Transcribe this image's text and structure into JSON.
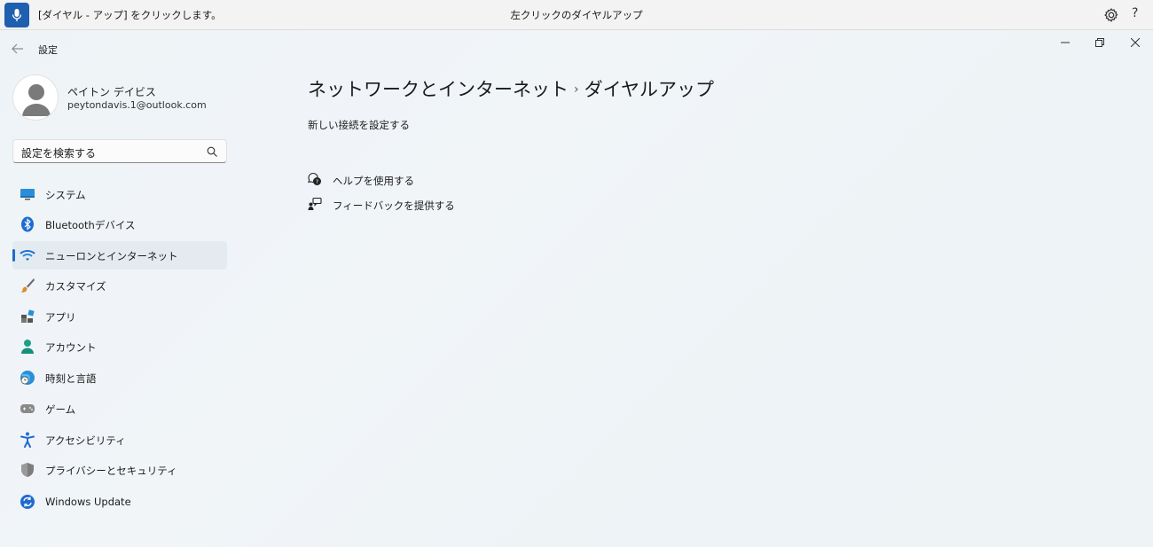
{
  "voice_bar": {
    "status": "[ダイヤル - アップ] をクリックします。",
    "center": "左クリックのダイヤルアップ",
    "help": "?"
  },
  "window": {
    "title": "設定"
  },
  "profile": {
    "name": "ペイトン デイビス",
    "email": "peytondavis.1@outlook.com"
  },
  "search": {
    "placeholder": "設定を検索する"
  },
  "nav": [
    {
      "label": "システム",
      "icon": "monitor-icon"
    },
    {
      "label": "Bluetoothデバイス",
      "icon": "bluetooth-icon"
    },
    {
      "label": "ニューロンとインターネット",
      "icon": "wifi-icon",
      "active": true
    },
    {
      "label": "カスタマイズ",
      "icon": "brush-icon"
    },
    {
      "label": "アプリ",
      "icon": "apps-icon"
    },
    {
      "label": "アカウント",
      "icon": "person-icon"
    },
    {
      "label": "時刻と言語",
      "icon": "globe-clock-icon"
    },
    {
      "label": "ゲーム",
      "icon": "gamepad-icon"
    },
    {
      "label": "アクセシビリティ",
      "icon": "accessibility-icon"
    },
    {
      "label": "プライバシーとセキュリティ",
      "icon": "shield-icon"
    },
    {
      "label": "Windows Update",
      "icon": "update-icon"
    }
  ],
  "main": {
    "breadcrumb_parent": "ネットワークとインターネット",
    "breadcrumb_sep": "›",
    "breadcrumb_current": "ダイヤルアップ",
    "new_connection": "新しい接続を設定する",
    "help_link": "ヘルプを使用する",
    "feedback_link": "フィードバックを提供する"
  },
  "colors": {
    "accent": "#1f6bd0",
    "active_bg": "#e4ebf0"
  }
}
